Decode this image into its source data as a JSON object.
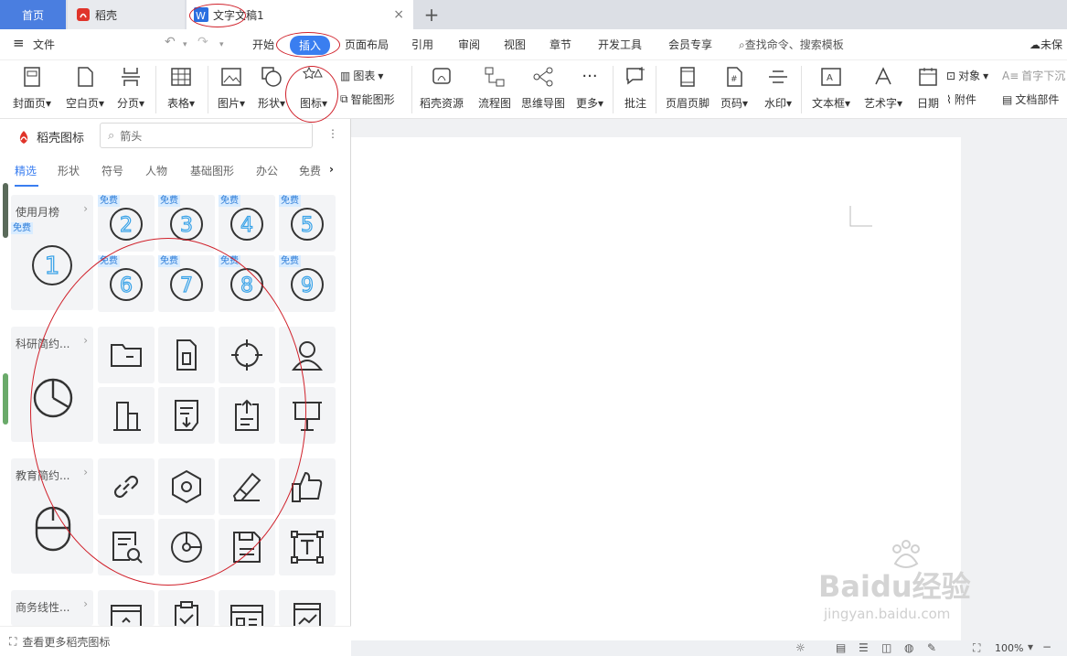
{
  "tabs": {
    "home": "首页",
    "daoke": "稻壳",
    "document": "文字文稿1",
    "add": "+",
    "close": "×"
  },
  "menu": {
    "file": "文件",
    "items": [
      "开始",
      "插入",
      "页面布局",
      "引用",
      "审阅",
      "视图",
      "章节",
      "开发工具",
      "会员专享"
    ],
    "search": "查找命令、搜索模板",
    "account": "未保"
  },
  "ribbon": {
    "cover": "封面页",
    "blank": "空白页",
    "pagebreak": "分页",
    "table": "表格",
    "picture": "图片",
    "shape": "形状",
    "icon": "图标",
    "chart": "图表",
    "smartart": "智能图形",
    "resources": "稻壳资源",
    "flowchart": "流程图",
    "mindmap": "思维导图",
    "more": "更多",
    "comment": "批注",
    "headerfooter": "页眉页脚",
    "pagenum": "页码",
    "watermark": "水印",
    "textbox": "文本框",
    "wordart": "艺术字",
    "date": "日期",
    "object": "对象",
    "attachment": "附件",
    "dropcap": "首字下沉",
    "docparts": "文档部件"
  },
  "panel": {
    "title": "稻壳图标",
    "search_placeholder": "箭头",
    "more_menu": "⋮",
    "categories": [
      "精选",
      "形状",
      "符号",
      "人物",
      "基础图形",
      "办公",
      "免费"
    ],
    "free_badge": "免费",
    "groups": [
      "使用月榜",
      "科研简约...",
      "教育简约...",
      "商务线性..."
    ],
    "number_icons": [
      "1",
      "2",
      "3",
      "4",
      "5",
      "6",
      "7",
      "8",
      "9"
    ],
    "footer": "查看更多稻壳图标"
  },
  "status": {
    "zoom": "100%"
  },
  "watermark_text": "Baidu经验",
  "watermark_url": "jingyan.baidu.com",
  "colors": {
    "accent": "#3a7ef0",
    "tab_home": "#4a7ee0",
    "annotation": "#d0202a",
    "badge_text": "#2a7bd8"
  }
}
